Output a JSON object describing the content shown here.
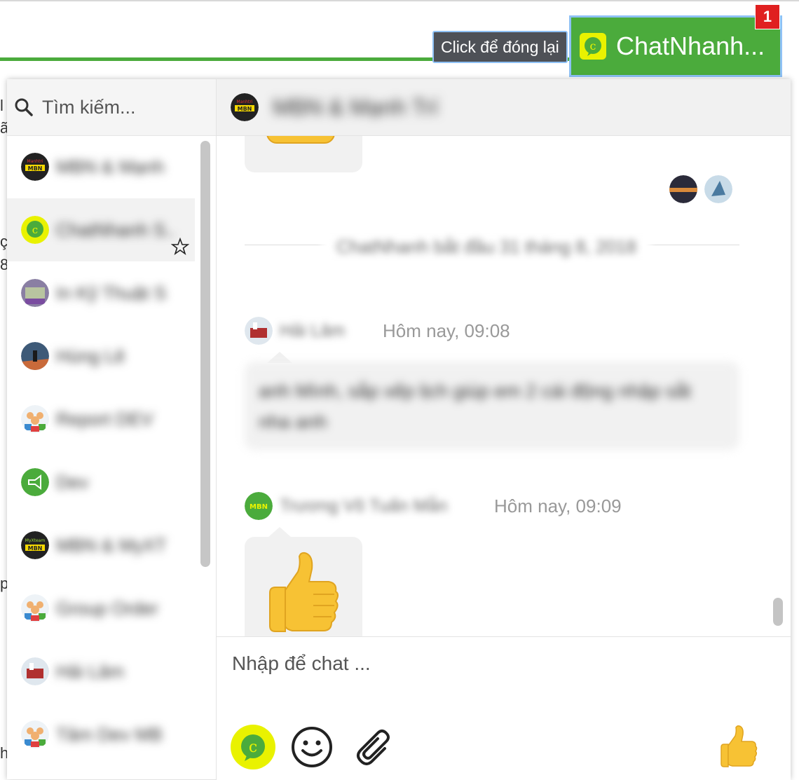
{
  "close_tooltip": "Click để đóng lại",
  "launcher": {
    "title": "ChatNhanh...",
    "badge": "1"
  },
  "search": {
    "placeholder": "Tìm kiếm..."
  },
  "conversations": [
    {
      "name": "MBN & Mạnh"
    },
    {
      "name": "ChatNhanh S..."
    },
    {
      "name": "In Kỹ Thuật S"
    },
    {
      "name": "Hùng Lê"
    },
    {
      "name": "Report DEV"
    },
    {
      "name": "Dev"
    },
    {
      "name": "MBN & MyXT"
    },
    {
      "name": "Group Order"
    },
    {
      "name": "Hải Lâm"
    },
    {
      "name": "Tâm Dev MB"
    }
  ],
  "header": {
    "title": "MBN & Mạnh Trí"
  },
  "messages": {
    "divider": "ChatNhanh bắt đầu 31 tháng 8, 2018",
    "msg1": {
      "sender": "Hải Lâm",
      "time": "Hôm nay, 09:08",
      "text": "anh Mình, sắp xếp lịch giúp em 2 cái động nhập sắt nha anh"
    },
    "msg2": {
      "sender": "Trương Võ Tuấn Mẫn",
      "time": "Hôm nay, 09:09"
    },
    "emoji_big": "👍"
  },
  "composer": {
    "placeholder": "Nhập để chat ...",
    "like": "👍"
  },
  "colors": {
    "brand_green": "#4bab3c",
    "logo_yellow": "#e9f200",
    "badge_red": "#e02020"
  }
}
